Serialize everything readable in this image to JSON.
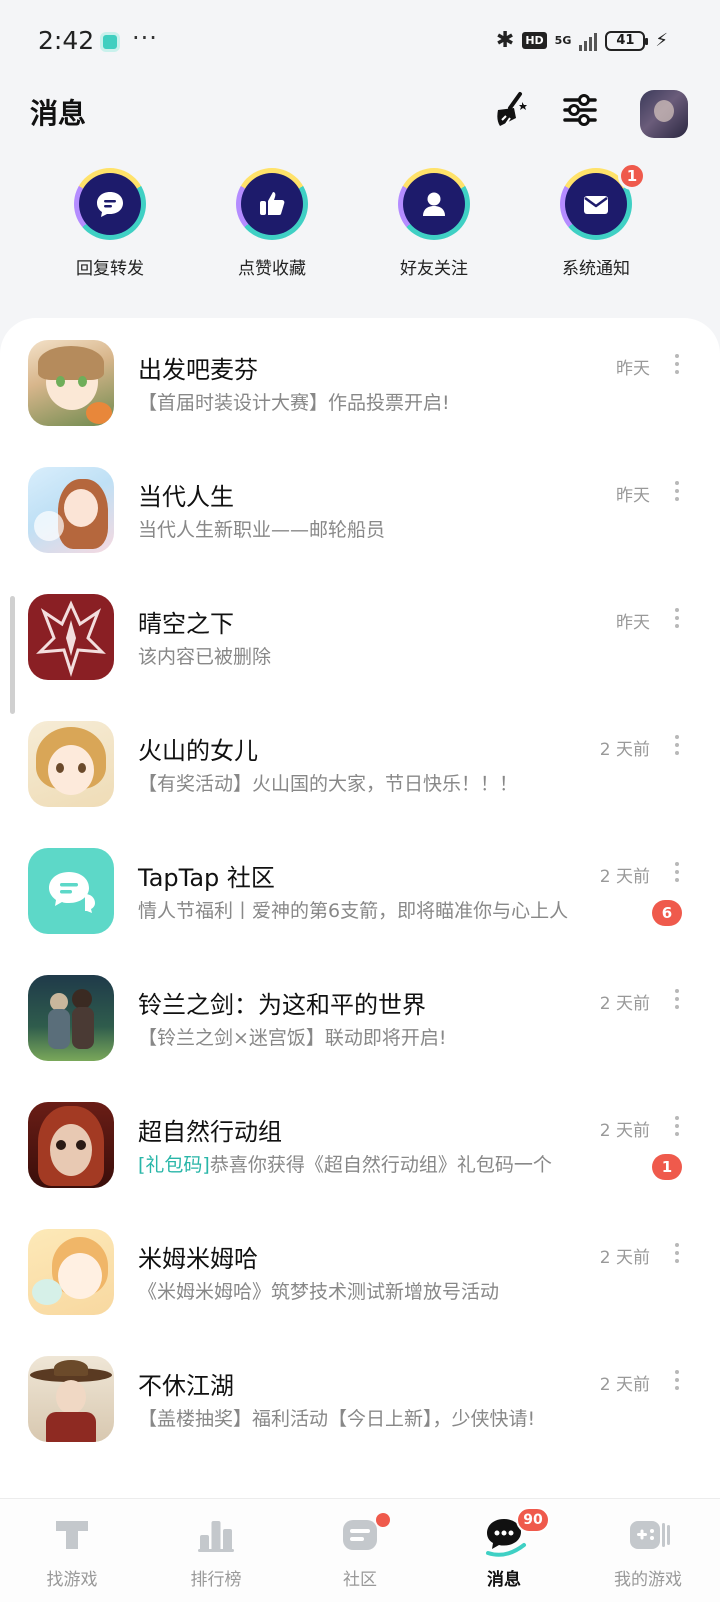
{
  "status_bar": {
    "time": "2:42",
    "dots": "···",
    "hd": "HD",
    "network": "5G",
    "battery": "41"
  },
  "header": {
    "title": "消息"
  },
  "quick_actions": [
    {
      "label": "回复转发",
      "icon": "chat-bubble-icon",
      "badge": ""
    },
    {
      "label": "点赞收藏",
      "icon": "thumbs-up-icon",
      "badge": ""
    },
    {
      "label": "好友关注",
      "icon": "person-icon",
      "badge": ""
    },
    {
      "label": "系统通知",
      "icon": "envelope-icon",
      "badge": "1"
    }
  ],
  "messages": [
    {
      "title": "出发吧麦芬",
      "subtitle": "【首届时装设计大赛】作品投票开启!",
      "tag": "",
      "time": "昨天",
      "badge": ""
    },
    {
      "title": "当代人生",
      "subtitle": "当代人生新职业——邮轮船员",
      "tag": "",
      "time": "昨天",
      "badge": ""
    },
    {
      "title": "晴空之下",
      "subtitle": "该内容已被删除",
      "tag": "",
      "time": "昨天",
      "badge": ""
    },
    {
      "title": "火山的女儿",
      "subtitle": "【有奖活动】火山国的大家，节日快乐！！！",
      "tag": "",
      "time": "2 天前",
      "badge": ""
    },
    {
      "title": "TapTap 社区",
      "subtitle": "情人节福利丨爱神的第6支箭，即将瞄准你与心上人",
      "tag": "",
      "time": "2 天前",
      "badge": "6"
    },
    {
      "title": "铃兰之剑：为这和平的世界",
      "subtitle": "【铃兰之剑×迷宫饭】联动即将开启!",
      "tag": "",
      "time": "2 天前",
      "badge": ""
    },
    {
      "title": "超自然行动组",
      "subtitle": "恭喜你获得《超自然行动组》礼包码一个",
      "tag": "[礼包码]",
      "time": "2 天前",
      "badge": "1"
    },
    {
      "title": "米姆米姆哈",
      "subtitle": "《米姆米姆哈》筑梦技术测试新增放号活动",
      "tag": "",
      "time": "2 天前",
      "badge": ""
    },
    {
      "title": "不休江湖",
      "subtitle": "【盖楼抽奖】福利活动【今日上新】，少侠快请!",
      "tag": "",
      "time": "2 天前",
      "badge": ""
    }
  ],
  "bottom_nav": [
    {
      "label": "找游戏",
      "icon": "discover-icon",
      "badge": "",
      "dot": false
    },
    {
      "label": "排行榜",
      "icon": "ranking-icon",
      "badge": "",
      "dot": false
    },
    {
      "label": "社区",
      "icon": "community-icon",
      "badge": "",
      "dot": true
    },
    {
      "label": "消息",
      "icon": "message-icon",
      "badge": "90",
      "dot": false,
      "active": true
    },
    {
      "label": "我的游戏",
      "icon": "my-games-icon",
      "badge": "",
      "dot": false
    }
  ],
  "colors": {
    "accent": "#29b6a8",
    "badge": "#ef5a4c",
    "ring_core": "#1d1b6b"
  }
}
